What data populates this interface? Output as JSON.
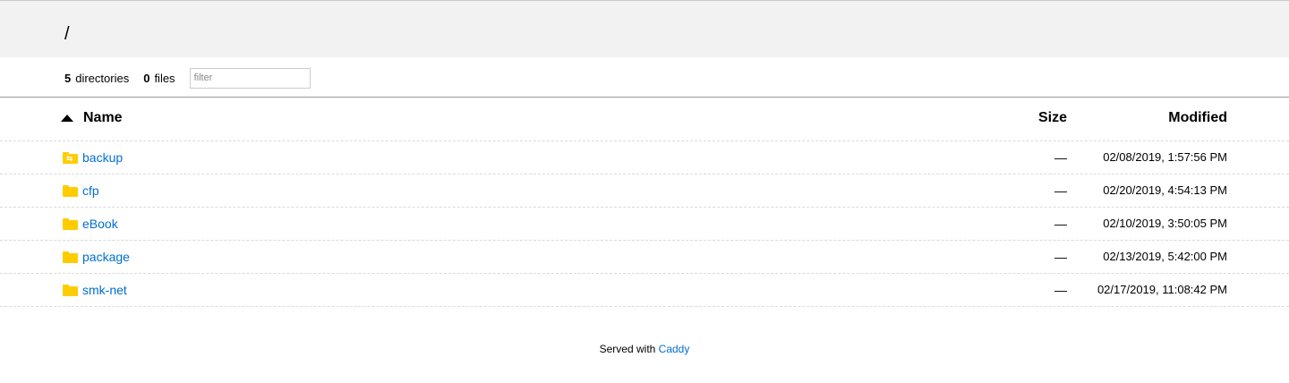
{
  "header": {
    "path": "/"
  },
  "summary": {
    "dir_count": "5",
    "dir_label": "directories",
    "file_count": "0",
    "file_label": "files",
    "filter_placeholder": "filter"
  },
  "table": {
    "columns": {
      "name": "Name",
      "size": "Size",
      "modified": "Modified"
    },
    "sort_icon": "triangle-up-icon",
    "rows": [
      {
        "name": "backup",
        "size": "—",
        "modified": "02/08/2019, 1:57:56 PM",
        "icon": "folder-symlink-icon"
      },
      {
        "name": "cfp",
        "size": "—",
        "modified": "02/20/2019, 4:54:13 PM",
        "icon": "folder-icon"
      },
      {
        "name": "eBook",
        "size": "—",
        "modified": "02/10/2019, 3:50:05 PM",
        "icon": "folder-icon"
      },
      {
        "name": "package",
        "size": "—",
        "modified": "02/13/2019, 5:42:00 PM",
        "icon": "folder-icon"
      },
      {
        "name": "smk-net",
        "size": "—",
        "modified": "02/17/2019, 11:08:42 PM",
        "icon": "folder-icon"
      }
    ]
  },
  "footer": {
    "text": "Served with",
    "link": "Caddy"
  },
  "colors": {
    "link": "#006ed3",
    "folder": "#ffcc00",
    "header_bg": "#f2f2f2"
  }
}
